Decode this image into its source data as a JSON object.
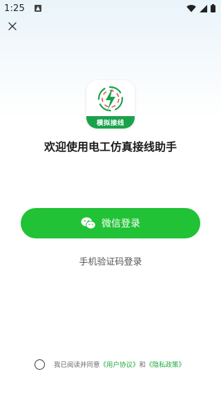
{
  "status_bar": {
    "time": "1:25",
    "icons": [
      "notification-icon",
      "wifi-icon",
      "signal-icon",
      "battery-icon"
    ]
  },
  "app": {
    "logo_text": "模拟接线",
    "title": "欢迎使用电工仿真接线助手"
  },
  "login": {
    "wechat_label": "微信登录",
    "sms_label": "手机验证码登录"
  },
  "agreement": {
    "prefix": "我已阅读并同意",
    "user_agreement": "《用户协议》",
    "conjunction": "和",
    "privacy_policy": "《隐私政策》"
  },
  "colors": {
    "primary_green": "#21c236",
    "link_green": "#1fa83c",
    "logo_green": "#1aa24b"
  }
}
